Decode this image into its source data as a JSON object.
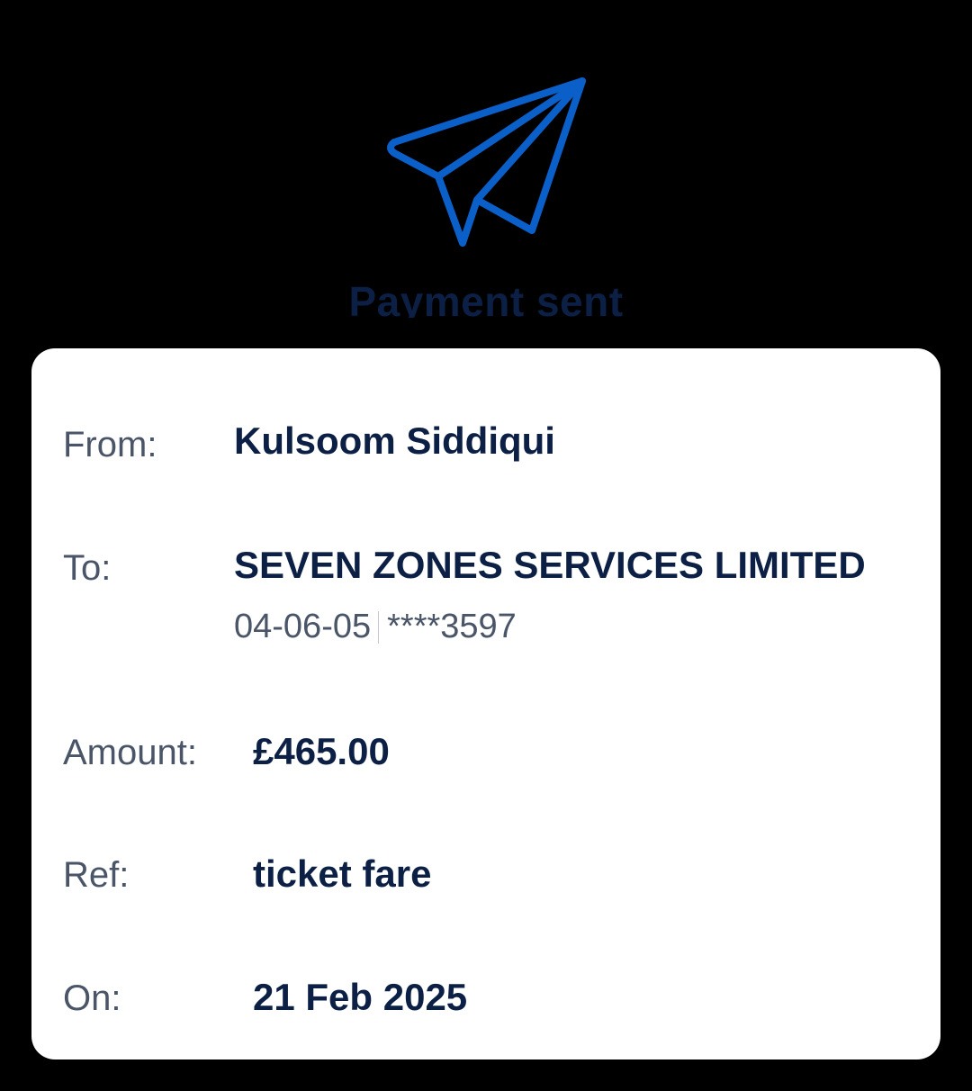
{
  "header": {
    "icon": "paper-plane-icon",
    "title": "Payment sent"
  },
  "colors": {
    "icon": "#0a60c8",
    "title": "#0c1f45",
    "label": "#4a5568",
    "value": "#0c1f45",
    "background": "#000000",
    "card": "#ffffff"
  },
  "details": {
    "from": {
      "label": "From:",
      "value": "Kulsoom Siddiqui"
    },
    "to": {
      "label": "To:",
      "value": "SEVEN ZONES SERVICES LIMITED",
      "sort_code": "04-06-05",
      "account": "****3597"
    },
    "amount": {
      "label": "Amount:",
      "value": "£465.00"
    },
    "ref": {
      "label": "Ref:",
      "value": "ticket fare"
    },
    "on": {
      "label": "On:",
      "value": "21 Feb 2025"
    }
  }
}
